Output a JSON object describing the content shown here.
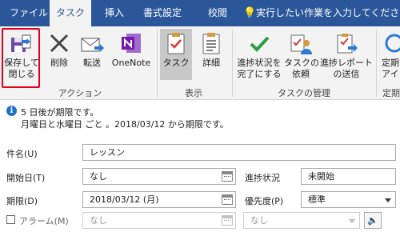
{
  "tabs": [
    {
      "label": "ファイル"
    },
    {
      "label": "タスク"
    },
    {
      "label": "挿入"
    },
    {
      "label": "書式設定"
    },
    {
      "label": "校閲"
    }
  ],
  "tellme": {
    "label": "実行したい作業を入力してください"
  },
  "ribbon": {
    "actions": {
      "save_close": [
        "保存して",
        "閉じる"
      ],
      "delete": "削除",
      "forward": "転送",
      "onenote": "OneNote",
      "group_label": "アクション"
    },
    "show": {
      "task": "タスク",
      "details": "詳細",
      "group_label": "表示"
    },
    "manage": {
      "mark_complete": [
        "進捗状況を",
        "完了にする"
      ],
      "assign": [
        "タスクの",
        "依頼"
      ],
      "send_status": [
        "進捗レポート",
        "の送信"
      ],
      "group_label": "タスクの管理"
    },
    "recurrence": {
      "label": [
        "定期",
        "アイ"
      ],
      "group_label": "定期"
    }
  },
  "info": {
    "line1": "5 日後が期限です。",
    "line2": "月曜日と水曜日 ごと 。2018/03/12 から期限です。"
  },
  "form": {
    "subject_label": "件名(U)",
    "subject_value": "レッスン",
    "start_label": "開始日(T)",
    "start_value": "なし",
    "due_label": "期限(D)",
    "due_value": "2018/03/12 (月)",
    "reminder_label": "アラーム(M)",
    "reminder_date": "なし",
    "reminder_time": "なし",
    "status_label": "進捗状況",
    "status_value": "未開始",
    "priority_label": "優先度(P)",
    "priority_value": "標準"
  },
  "colors": {
    "tab_bar": "#2b579a",
    "ribbon_bg": "#f3f3f3",
    "highlight_border": "#e0001b",
    "onenote": "#7719aa",
    "check_green": "#2e9e46",
    "info_blue": "#1e6fc8"
  }
}
